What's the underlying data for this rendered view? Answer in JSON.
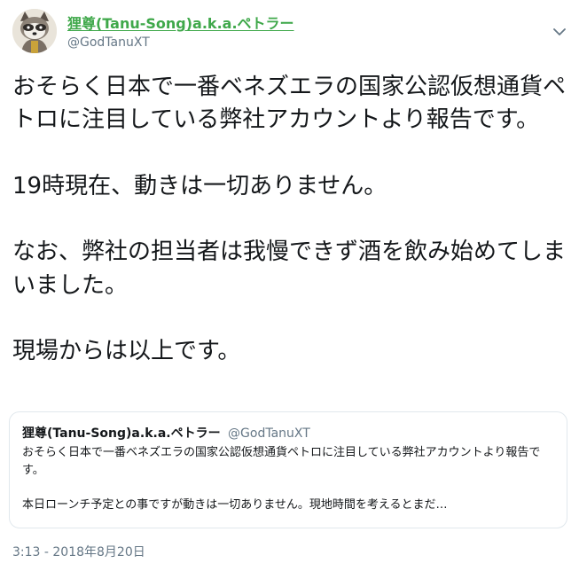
{
  "tweet": {
    "author": {
      "display_name": "狸尊(Tanu-Song)a.k.a.ペトラー",
      "handle": "@GodTanuXT",
      "avatar_icon": "raccoon-avatar"
    },
    "body": "おそらく日本で一番ベネズエラの国家公認仮想通貨ペトロに注目している弊社アカウントより報告です。\n\n19時現在、動きは一切ありません。\n\nなお、弊社の担当者は我慢できず酒を飲み始めてしまいました。\n\n現場からは以上です。",
    "quoted": {
      "display_name": "狸尊(Tanu-Song)a.k.a.ペトラー",
      "handle": "@GodTanuXT",
      "text": "おそらく日本で一番ベネズエラの国家公認仮想通貨ペトロに注目している弊社アカウントより報告です。\n\n本日ローンチ予定との事ですが動きは一切ありません。現地時間を考えるとまだ…"
    },
    "timestamp": "3:13 - 2018年8月20日",
    "menu_icon": "chevron-down-icon",
    "colors": {
      "name_green": "#3fa84a",
      "secondary_gray": "#657786",
      "border": "#e1e8ed"
    }
  }
}
